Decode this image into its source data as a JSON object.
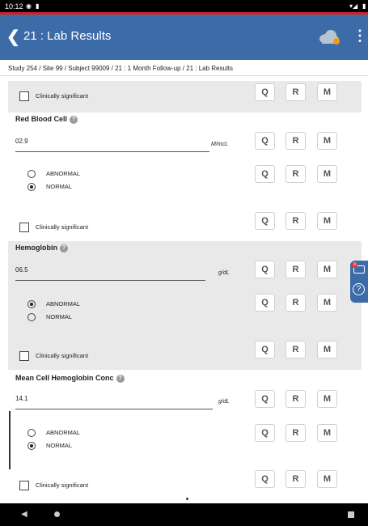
{
  "status_bar": {
    "time": "10:12"
  },
  "app_bar": {
    "back_icon": "chevron-left-icon",
    "title": "21 : Lab Results",
    "menu_icon": "⋮"
  },
  "breadcrumb": "Study 254 / Site 99 / Subject 99009 / 21 : 1 Month Follow-up / 21 : Lab Results",
  "buttons": {
    "q": "Q",
    "r": "R",
    "m": "M"
  },
  "clinically_significant_label": "Clinically significant",
  "help_glyph": "?",
  "fields": [
    {
      "name": "Red Blood Cell",
      "value": "02.9",
      "unit": "M/mcL",
      "options": [
        "ABNORMAL",
        "NORMAL"
      ],
      "selected": "NORMAL"
    },
    {
      "name": "Hemoglobin",
      "value": "06.5",
      "unit": "g/dL",
      "options": [
        "ABNORMAL",
        "NORMAL"
      ],
      "selected": "ABNORMAL"
    },
    {
      "name": "Mean Cell Hemoglobin Conc",
      "value": "14.1",
      "unit": "g/dL",
      "options": [
        "ABNORMAL",
        "NORMAL"
      ],
      "selected": "NORMAL"
    }
  ],
  "side_tabs": {
    "badge": "0",
    "help": "?"
  },
  "colors": {
    "app_bar": "#3c6ba8",
    "status_accent": "#d21f27",
    "section_gray": "#e9e9e9"
  }
}
